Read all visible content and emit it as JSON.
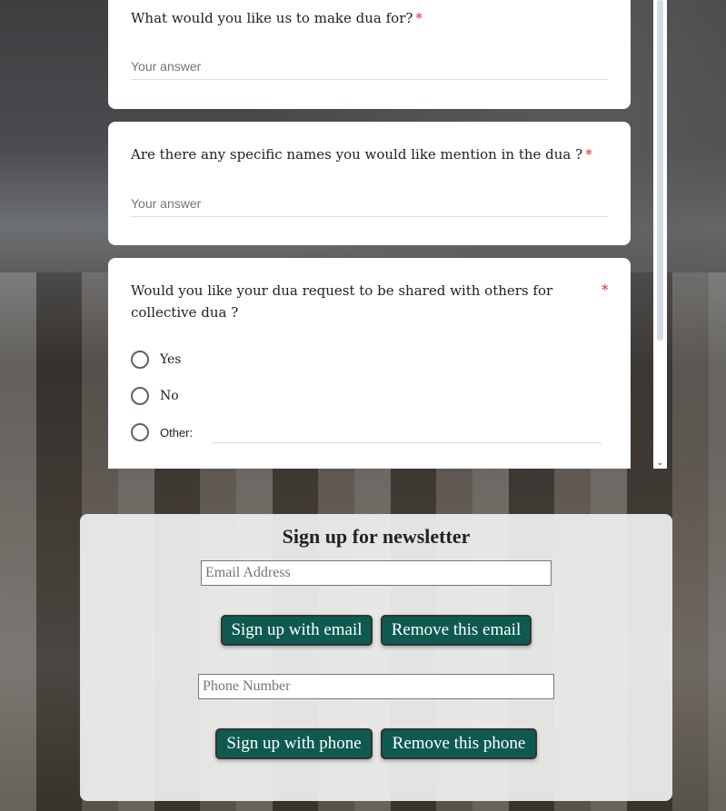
{
  "form": {
    "questions": [
      {
        "text": "What would you like us to make dua for?",
        "required": "*",
        "placeholder": "Your answer"
      },
      {
        "text": "Are there any specific names you would like mention in the dua ?",
        "required": "*",
        "placeholder": "Your answer"
      },
      {
        "text": "Would you like your dua request to be shared with others for collective dua ?",
        "required": "*",
        "options": [
          "Yes",
          "No",
          "Other:"
        ]
      }
    ]
  },
  "newsletter": {
    "title": "Sign up for newsletter",
    "email_placeholder": "Email Address",
    "signup_email": "Sign up with email",
    "remove_email": "Remove this email",
    "phone_placeholder": "Phone Number",
    "signup_phone": "Sign up with phone",
    "remove_phone": "Remove this phone"
  }
}
